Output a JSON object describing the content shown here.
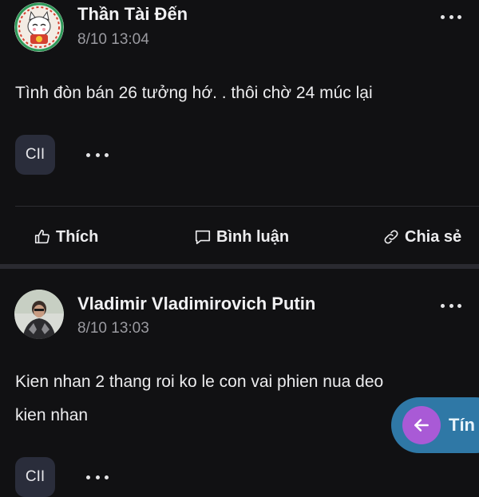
{
  "posts": [
    {
      "author": "Thần Tài Đến",
      "time": "8/10 13:04",
      "content": "Tình đòn bán 26 tưởng hớ. . thôi chờ 24 múc lại",
      "tag": "CII"
    },
    {
      "author": "Vladimir Vladimirovich Putin",
      "time": "8/10 13:03",
      "content_line1": "Kien nhan 2 thang roi ko le con vai phien nua deo",
      "content_line2": "kien nhan",
      "tag": "CII"
    }
  ],
  "actions": {
    "like_label": "Thích",
    "comment_label": "Bình luận",
    "share_label": "Chia sẻ"
  },
  "fab": {
    "label": "Tín"
  },
  "icons": {
    "like": "thumbs-up-icon",
    "comment": "comment-icon",
    "share": "link-icon",
    "more": "more-horizontal-icon",
    "back": "arrow-left-icon"
  },
  "colors": {
    "background": "#111113",
    "tag_bg": "#2a2d3b",
    "fab_bg": "#2f78a6",
    "fab_circle": "#a95ad6",
    "muted_text": "#9a9aa0"
  }
}
